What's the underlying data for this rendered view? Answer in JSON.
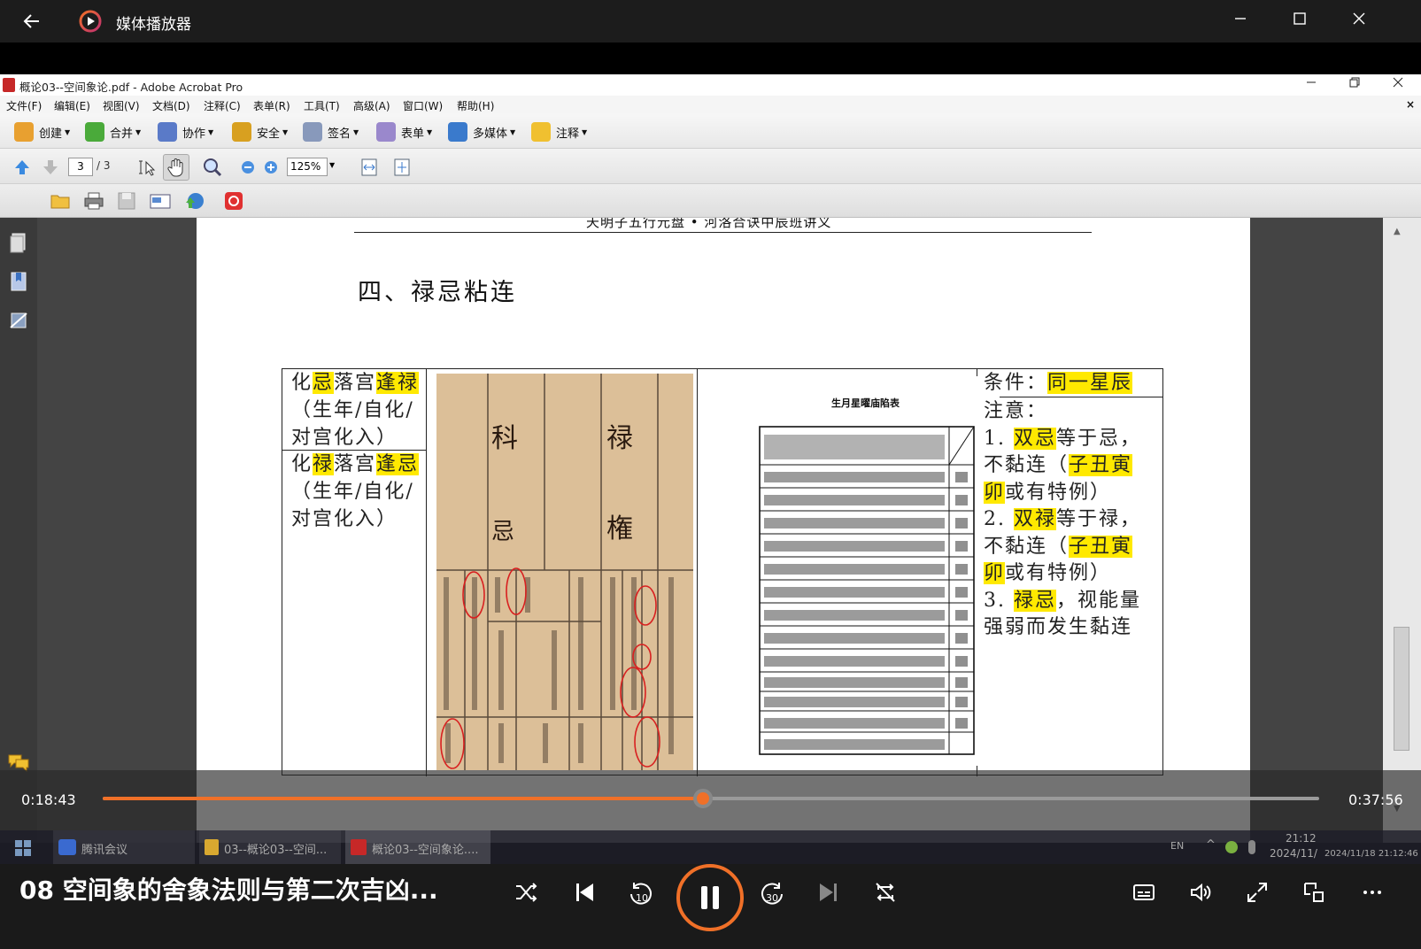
{
  "player": {
    "title": "媒体播放器",
    "time_current": "0:18:43",
    "time_total": "0:37:56",
    "progress": 0.4935,
    "episode_title": "08 空间象的舍象法则与第二次吉凶..."
  },
  "acrobat": {
    "window_title": "概论03--空间象论.pdf - Adobe Acrobat Pro",
    "menu": [
      "文件(F)",
      "编辑(E)",
      "视图(V)",
      "文档(D)",
      "注释(C)",
      "表单(R)",
      "工具(T)",
      "高级(A)",
      "窗口(W)",
      "帮助(H)"
    ],
    "toolbar": [
      "创建",
      "合并",
      "协作",
      "安全",
      "签名",
      "表单",
      "多媒体",
      "注释"
    ],
    "page_current": "3",
    "page_total": "/ 3",
    "zoom": "125%"
  },
  "doc": {
    "header": "天明子五行元盘 • 河洛合诀中辰班讲义",
    "section_title": "四、禄忌粘连",
    "col1": {
      "r1": [
        "化",
        "忌",
        "落宫",
        "逢禄",
        "（生年/自化/",
        "对宫化入）"
      ],
      "r2": [
        "化",
        "禄",
        "落宫",
        "逢忌",
        "（生年/自化/",
        "对宫化入）"
      ]
    },
    "scan_labels": [
      "科",
      "禄",
      "忌",
      "権"
    ],
    "table2_title": "生月星曜庙陷表",
    "col4": {
      "cond_label": "条件：",
      "cond_value": "同一星辰",
      "note": "注意：",
      "l1a": "1. ",
      "l1b": "双忌",
      "l1c": "等于忌，",
      "l2a": "不黏连（",
      "l2b": "子丑寅",
      "l3a": "卯",
      "l3b": "或有特例）",
      "l4a": "2. ",
      "l4b": "双禄",
      "l4c": "等于禄，",
      "l5a": "不黏连（",
      "l5b": "子丑寅",
      "l6a": "卯",
      "l6b": "或有特例）",
      "l7a": "3. ",
      "l7b": "禄忌",
      "l7c": "，视能量",
      "l8": "强弱而发生黏连"
    }
  },
  "taskbar": {
    "items": [
      "腾讯会议",
      "03--概论03--空间...",
      "概论03--空间象论...."
    ],
    "lang": "EN",
    "clock": "21:12",
    "date": "2024/11/",
    "stamp": "2024/11/18 21:12:46"
  }
}
